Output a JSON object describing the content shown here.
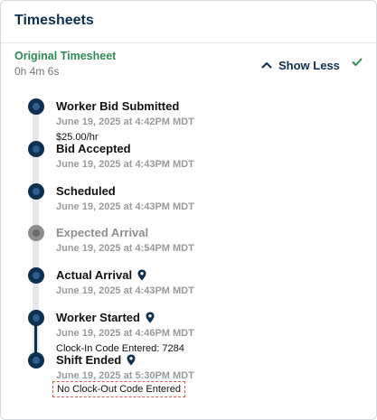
{
  "card": {
    "title": "Timesheets"
  },
  "section": {
    "title": "Original Timesheet",
    "duration": "0h 4m 6s",
    "toggle_label": "Show Less"
  },
  "icons": {
    "toggle": "chevron-up-icon",
    "status": "checkmark-icon",
    "location": "location-pin-icon",
    "step": "timeline-dot-icon"
  },
  "colors": {
    "primary": "#0e3050",
    "success": "#2e8b57",
    "muted": "#8e8e8e",
    "alert": "#e05a4f"
  },
  "events": [
    {
      "title": "Worker Bid Submitted",
      "time": "June 19, 2025 at 4:42PM MDT",
      "note": "$25.00/hr"
    },
    {
      "title": "Bid Accepted",
      "time": "June 19, 2025 at 4:43PM MDT"
    },
    {
      "title": "Scheduled",
      "time": "June 19, 2025 at 4:43PM MDT"
    },
    {
      "title": "Expected Arrival",
      "time": "June 19, 2025 at 4:54PM MDT"
    },
    {
      "title": "Actual Arrival",
      "time": "June 19, 2025 at 4:43PM MDT"
    },
    {
      "title": "Worker Started",
      "time": "June 19, 2025 at 4:46PM MDT",
      "note": "Clock-In Code Entered: 7284"
    },
    {
      "title": "Shift Ended",
      "time": "June 19, 2025 at 5:30PM MDT",
      "note": "No Clock-Out Code Entered"
    }
  ]
}
